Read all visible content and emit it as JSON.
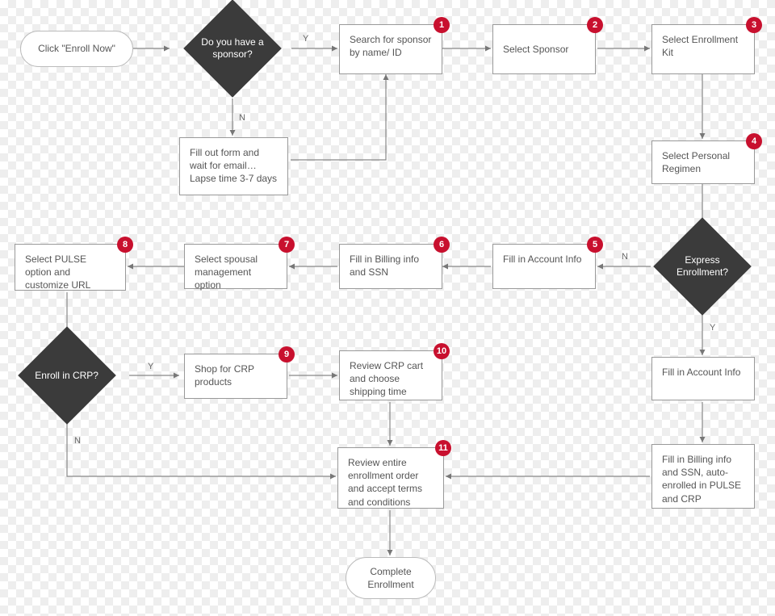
{
  "flow": {
    "start": "Click \"Enroll Now\"",
    "complete": "Complete Enrollment",
    "decisions": {
      "sponsor": "Do you have a sponsor?",
      "express": "Express Enrollment?",
      "crp": "Enroll in CRP?"
    },
    "labels": {
      "yes": "Y",
      "no": "N"
    },
    "steps": {
      "s1": "Search for sponsor by name/ ID",
      "s2": "Select Sponsor",
      "s3": "Select Enrollment Kit",
      "s4": "Select Personal Regimen",
      "s5": "Fill in Account Info",
      "s6": "Fill in Billing info and SSN",
      "s7": "Select spousal management option",
      "s8": "Select PULSE option and customize URL",
      "s9": "Shop for CRP products",
      "s10": "Review CRP cart and choose shipping time",
      "s11": "Review entire enrollment order and accept terms and conditions"
    },
    "plain": {
      "noSponsor": "Fill out form and wait for email… Lapse time 3-7 days",
      "expressAcct": "Fill in Account Info",
      "expressBilling": "Fill in Billing info and SSN, auto-enrolled in PULSE and CRP"
    },
    "badges": {
      "s1": "1",
      "s2": "2",
      "s3": "3",
      "s4": "4",
      "s5": "5",
      "s6": "6",
      "s7": "7",
      "s8": "8",
      "s9": "9",
      "s10": "10",
      "s11": "11"
    }
  }
}
